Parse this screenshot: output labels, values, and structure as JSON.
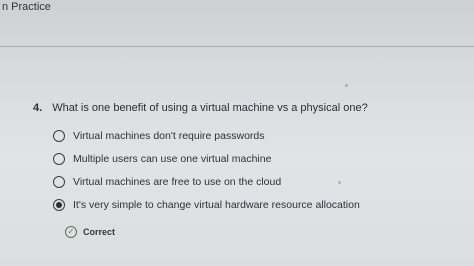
{
  "header": {
    "title": "n Practice"
  },
  "question": {
    "number": "4.",
    "text": "What is one benefit of using a virtual machine vs a physical one?"
  },
  "options": [
    {
      "label": "Virtual machines don't require passwords",
      "selected": false
    },
    {
      "label": "Multiple users can use one virtual machine",
      "selected": false
    },
    {
      "label": "Virtual machines are free to use on the cloud",
      "selected": false
    },
    {
      "label": "It's very simple to change virtual hardware resource allocation",
      "selected": true
    }
  ],
  "result": {
    "label": "Correct",
    "icon": "check-circle-icon",
    "color": "#4b7a58"
  }
}
